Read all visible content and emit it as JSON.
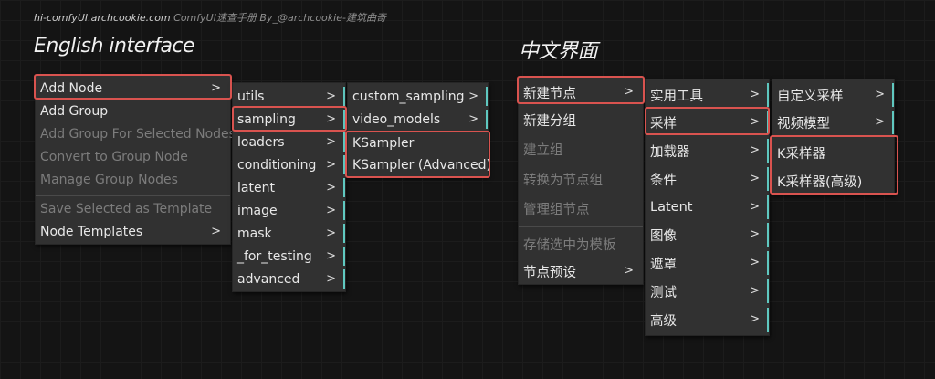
{
  "credit": {
    "site": "hi-comfyUI.archcookie.com",
    "rest": " ComfyUI速查手册 By_@archcookie-建筑曲奇"
  },
  "english": {
    "title": "English interface",
    "main_menu": [
      {
        "label": "Add Node",
        "arrow": ">",
        "disabled": false
      },
      {
        "label": "Add Group",
        "disabled": false
      },
      {
        "label": "Add Group For Selected Nodes",
        "disabled": true
      },
      {
        "label": "Convert to Group Node",
        "disabled": true
      },
      {
        "label": "Manage Group Nodes",
        "disabled": true
      },
      {
        "label": "Save Selected as Template",
        "disabled": true
      },
      {
        "label": "Node Templates",
        "arrow": ">",
        "disabled": false
      }
    ],
    "category_menu": [
      "utils",
      "sampling",
      "loaders",
      "conditioning",
      "latent",
      "image",
      "mask",
      "_for_testing",
      "advanced"
    ],
    "sampling_menu": [
      "custom_sampling",
      "video_models",
      "KSampler",
      "KSampler (Advanced)"
    ]
  },
  "chinese": {
    "title": "中文界面",
    "main_menu": [
      {
        "label": "新建节点",
        "arrow": ">",
        "disabled": false
      },
      {
        "label": "新建分组",
        "disabled": false
      },
      {
        "label": "建立组",
        "disabled": true
      },
      {
        "label": "转换为节点组",
        "disabled": true
      },
      {
        "label": "管理组节点",
        "disabled": true
      },
      {
        "label": "存储选中为模板",
        "disabled": true
      },
      {
        "label": "节点预设",
        "arrow": ">",
        "disabled": false
      }
    ],
    "category_menu": [
      "实用工具",
      "采样",
      "加载器",
      "条件",
      "Latent",
      "图像",
      "遮罩",
      "测试",
      "高级"
    ],
    "sampling_menu": [
      "自定义采样",
      "视频模型",
      "K采样器",
      "K采样器(高级)"
    ]
  },
  "colors": {
    "highlight": "#d9534f",
    "submenu_bar": "#5fc8c0",
    "menu_bg": "#313131"
  },
  "icons": {
    "submenu": "chevron-right-icon"
  }
}
